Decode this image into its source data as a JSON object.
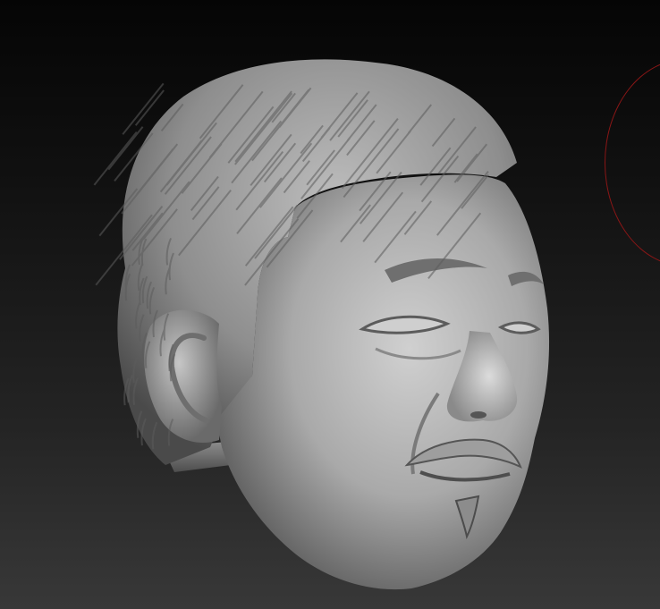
{
  "viewport": {
    "background_top": "#050505",
    "background_bottom": "#383838"
  },
  "model": {
    "subject": "sculpted-male-head",
    "material_color": "#a8a8a8",
    "highlight_color": "#d4d4d4",
    "shadow_color": "#2e2e2e"
  },
  "brush_cursor": {
    "color": "#8a1616",
    "shape": "circle"
  }
}
